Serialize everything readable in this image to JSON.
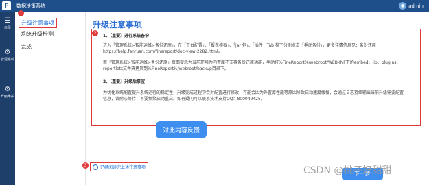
{
  "app": {
    "title": "数据决策系统",
    "user": "admin"
  },
  "leftnav": [
    {
      "icon": "☰",
      "label": "目录"
    },
    {
      "icon": "⚙",
      "label": "管理系统"
    },
    {
      "icon": "⚙",
      "label": "升级维护"
    }
  ],
  "sidebar": {
    "items": [
      {
        "label": "升级注意事项",
        "active": true
      },
      {
        "label": "系统升级检测"
      },
      {
        "label": "完成"
      }
    ]
  },
  "markers": [
    "1",
    "2",
    "3"
  ],
  "main": {
    "title": "升级注意事项",
    "section1_heading": "1、【重要】进行系统备份",
    "section1_text1": "进入「管理系统>智能运维>备份还原」，在「平台配置」、「报表模板」、「jar 包」、「插件」Tab 栏下分别点击「手动备份」，更多详情信息见：备份还原 https://help.fanruan.com/finereport/doc-view-2282.html。",
    "section1_text2": "若「管理系统>智能运维>备份还原」页面提示为当前环境为内置库不支持备份还原功能，手动将%FineReport%/webroot/WEB-INF下的embed、lib、plugins、reportlets文件夹拷贝到%FineReport%/webroot/backup目录下。",
    "section2_heading": "2、【重要】升级后事宜",
    "section2_text": "为优化系统配置提升系统运行的稳定性，升级完成过程中会对配置进行修改，可能会因为外置库性能等原因导致启动速度缓慢，会通过日志持续输出当前升级需要配置信息，请耐心等待，不要频繁启动重启。如有疑问可以联系技术支持QQ：800049425。",
    "feedback_button": "对此内容反馈",
    "confirm_label": "已经阅读完上述注意事项",
    "next_button": "下一步"
  },
  "watermark": "CSDN @桃子好甜甜"
}
